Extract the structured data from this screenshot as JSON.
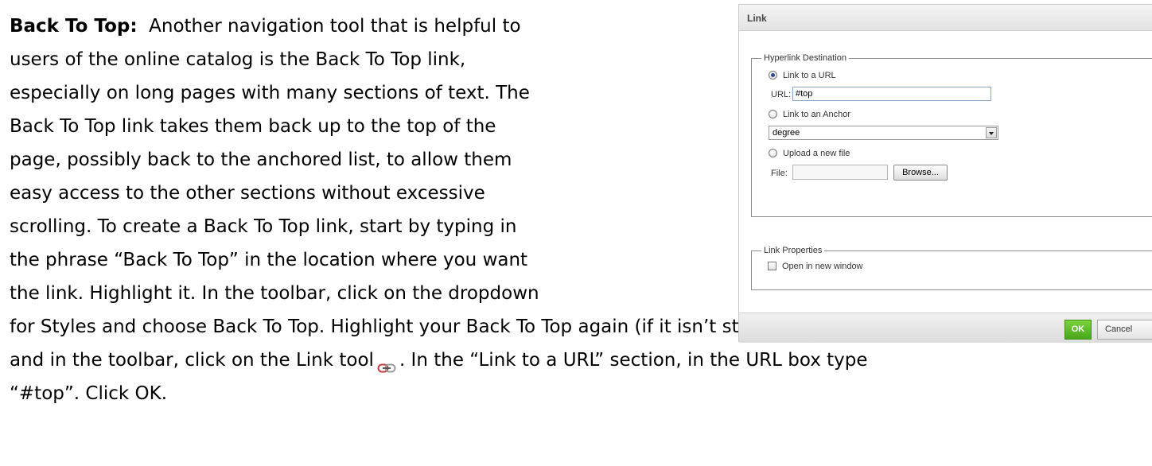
{
  "document": {
    "heading": "Back To Top:",
    "line1_rest": "Another navigation tool that is helpful to",
    "line2": "users of the online catalog is the Back To Top link,",
    "line3": "especially on long pages with many sections of text.  The",
    "line4": "Back To Top link takes them back up to the top of the",
    "line5": "page, possibly back to the anchored list, to allow them",
    "line6": "easy access to the other sections without excessive",
    "line7": "scrolling.  To create a Back To Top link, start by typing in",
    "line8": "the phrase “Back To Top” in the location where you want",
    "line9": "the link.  Highlight it.  In the toolbar, click on the dropdown",
    "line10": "for Styles and choose Back To Top.  Highlight your Back To Top again (if it isn’t still highlighted)",
    "line11_before_icon": "and in the toolbar, click on the Link tool",
    "line11_after_icon": ".  In the “Link to a URL” section, in the URL box type",
    "line12": "“#top”.  Click OK.",
    "inline_icon": "link-chain-icon"
  },
  "dialog": {
    "title": "Link",
    "destination": {
      "legend": "Hyperlink Destination",
      "link_url_label": "Link to a URL",
      "url_field_label": "URL:",
      "url_value": "#top",
      "link_anchor_label": "Link to an Anchor",
      "anchor_selected": "degree",
      "upload_label": "Upload a new file",
      "file_field_label": "File:",
      "browse_label": "Browse..."
    },
    "properties": {
      "legend": "Link Properties",
      "new_window_label": "Open in new window"
    },
    "ok_label": "OK",
    "cancel_label": "Cancel",
    "colors": {
      "ok_button": "#5bbd2a",
      "fieldset_border": "#8c8c8c"
    }
  }
}
